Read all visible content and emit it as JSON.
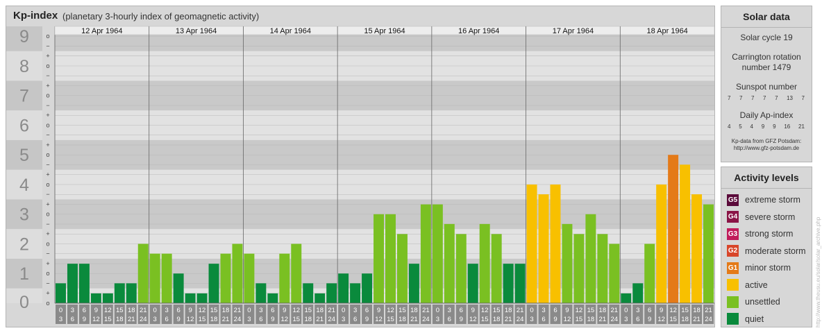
{
  "header": {
    "title": "Kp-index",
    "subtitle": "(planetary 3-hourly index of geomagnetic activity)"
  },
  "chart_data": {
    "type": "bar",
    "y_range": [
      0,
      9
    ],
    "y_ticks": [
      "0",
      "1",
      "2",
      "3",
      "4",
      "5",
      "6",
      "7",
      "8",
      "9"
    ],
    "minor_labels": [
      "−",
      "o",
      "+"
    ],
    "days": [
      {
        "date": "12 Apr 1964",
        "values": [
          0.67,
          1.33,
          1.33,
          0.33,
          0.33,
          0.67,
          0.67,
          2.0
        ]
      },
      {
        "date": "13 Apr 1964",
        "values": [
          1.67,
          1.67,
          1.0,
          0.33,
          0.33,
          1.33,
          1.67,
          2.0
        ]
      },
      {
        "date": "14 Apr 1964",
        "values": [
          1.67,
          0.67,
          0.33,
          1.67,
          2.0,
          0.67,
          0.33,
          0.67
        ]
      },
      {
        "date": "15 Apr 1964",
        "values": [
          1.0,
          0.67,
          1.0,
          3.0,
          3.0,
          2.33,
          1.33,
          3.33
        ]
      },
      {
        "date": "16 Apr 1964",
        "values": [
          3.33,
          2.67,
          2.33,
          1.33,
          2.67,
          2.33,
          1.33,
          1.33
        ]
      },
      {
        "date": "17 Apr 1964",
        "values": [
          4.0,
          3.67,
          4.0,
          2.67,
          2.33,
          3.0,
          2.33,
          2.0
        ]
      },
      {
        "date": "18 Apr 1964",
        "values": [
          0.33,
          0.67,
          2.0,
          4.0,
          5.0,
          4.67,
          3.67,
          3.33
        ]
      }
    ],
    "time_labels_top": [
      "0",
      "3",
      "6",
      "9",
      "12",
      "15",
      "18",
      "21"
    ],
    "time_labels_bottom": [
      "3",
      "6",
      "9",
      "12",
      "15",
      "18",
      "21",
      "24"
    ],
    "colors": {
      "quiet": "#0a8a3c",
      "unsettled": "#7ac022",
      "active": "#f8c000",
      "minor": "#e47a18",
      "moderate": "#d8462a",
      "strong": "#c11b5a",
      "severe": "#8a1446",
      "extreme": "#5a0a3a"
    }
  },
  "solar": {
    "title": "Solar data",
    "cycle": "Solar cycle 19",
    "carrington_line1": "Carrington rotation",
    "carrington_line2": "number 1479",
    "sunspot_label": "Sunspot number",
    "sunspot_values": [
      "7",
      "7",
      "7",
      "7",
      "7",
      "13",
      "7"
    ],
    "ap_label": "Daily Ap-index",
    "ap_values": [
      "4",
      "5",
      "4",
      "9",
      "9",
      "16",
      "21"
    ],
    "source_line1": "Kp-data from GFZ Potsdam:",
    "source_line2": "http://www.gfz-potsdam.de"
  },
  "levels": {
    "title": "Activity levels",
    "items": [
      {
        "badge": "G5",
        "label": "extreme storm",
        "color": "#5a0a3a"
      },
      {
        "badge": "G4",
        "label": "severe storm",
        "color": "#8a1446"
      },
      {
        "badge": "G3",
        "label": "strong storm",
        "color": "#c11b5a"
      },
      {
        "badge": "G2",
        "label": "moderate storm",
        "color": "#d8462a"
      },
      {
        "badge": "G1",
        "label": "minor storm",
        "color": "#e47a18"
      },
      {
        "badge": "",
        "label": "active",
        "color": "#f8c000"
      },
      {
        "badge": "",
        "label": "unsettled",
        "color": "#7ac022"
      },
      {
        "badge": "",
        "label": "quiet",
        "color": "#0a8a3c"
      }
    ]
  },
  "watermark": "http://www.theusu.eu/solar/solar_archive.php"
}
